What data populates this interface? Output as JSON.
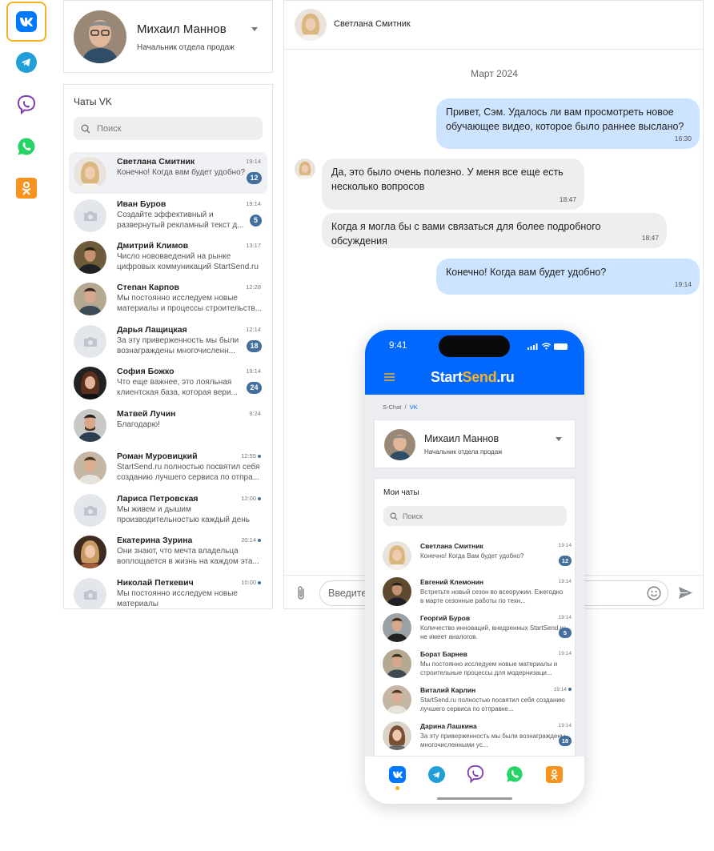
{
  "rail": {
    "items": [
      {
        "name": "vk-icon",
        "glyph": "VK",
        "color": "#0077ff",
        "active": true
      },
      {
        "name": "telegram-icon",
        "color": "#229ed9"
      },
      {
        "name": "viber-icon",
        "color": "#7d3daf"
      },
      {
        "name": "whatsapp-icon",
        "color": "#25d366"
      },
      {
        "name": "odnoklassniki-icon",
        "color": "#f7931e"
      }
    ]
  },
  "profile": {
    "name": "Михаил Маннов",
    "role": "Начальник отдела продаж"
  },
  "chat_list": {
    "title": "Чаты VK",
    "search_placeholder": "Поиск",
    "items": [
      {
        "name": "Светлана Смитник",
        "preview": "Конечно! Когда вам будет удобно?",
        "time": "19:14",
        "badge": "12"
      },
      {
        "name": "Иван Буров",
        "preview": "Создайте эффективный и развернутый рекламный текст д...",
        "time": "19:14",
        "badge": "5"
      },
      {
        "name": "Дмитрий Климов",
        "preview": "Число нововведений на рынке цифровых коммуникаций StartSend.ru",
        "time": "13:17"
      },
      {
        "name": "Степан Карпов",
        "preview": "Мы постоянно исследуем новые материалы и процессы строительств...",
        "time": "12:28"
      },
      {
        "name": "Дарья Лащицкая",
        "preview": "За эту приверженность мы были вознаграждены многочисленн...",
        "time": "12:14",
        "badge": "18"
      },
      {
        "name": "София Божко",
        "preview": "Что еще важнее, это лояльная клиентская база, которая вери...",
        "time": "19:14",
        "badge": "24"
      },
      {
        "name": "Матвей Лучин",
        "preview": "Благодарю!",
        "time": "9:24"
      },
      {
        "name": "Роман Муровицкий",
        "preview": "StartSend.ru полностью посвятил себя созданию лучшего сервиса по отпра...",
        "time": "12:55"
      },
      {
        "name": "Лариса Петровская",
        "preview": "Мы живем и дышим производительностью каждый день",
        "time": "12:00"
      },
      {
        "name": "Екатерина Зурина",
        "preview": "Они знают, что мечта владельца воплощается в жизнь на каждом эта...",
        "time": "20:14"
      },
      {
        "name": "Николай Петкевич",
        "preview": "Мы постоянно исследуем новые материалы",
        "time": "10:00"
      }
    ]
  },
  "conversation": {
    "contact": "Светлана Смитник",
    "date_divider": "Март 2024",
    "messages": [
      {
        "dir": "out",
        "text": "Привет, Сэм. Удалось ли вам просмотреть новое обучающее видео, которое было раннее выслано?",
        "time": "16:30"
      },
      {
        "dir": "in",
        "text": "Да, это было очень полезно. У меня все еще есть несколько вопросов",
        "time": "18:47"
      },
      {
        "dir": "in",
        "text": "Когда я могла бы с вами связаться для более подробного обсуждения",
        "time": "18:47"
      },
      {
        "dir": "out",
        "text": "Конечно! Когда вам будет удобно?",
        "time": "19:14"
      }
    ],
    "input_placeholder": "Введите"
  },
  "phone": {
    "clock": "9:41",
    "brand_a": "Start",
    "brand_b": "Send",
    "brand_c": ".ru",
    "breadcrumb_root": "S-Chat",
    "breadcrumb_sep": "/",
    "breadcrumb_current": "VK",
    "profile": {
      "name": "Михаил Маннов",
      "role": "Начальник отдела продаж"
    },
    "list_title": "Мои чаты",
    "search_placeholder": "Поиск",
    "items": [
      {
        "name": "Светлана Смитник",
        "preview": "Конечно! Когда Вам будет удобно?",
        "time": "19:14",
        "badge": "12"
      },
      {
        "name": "Евгений Клемонин",
        "preview": "Встретьте новый сезон во всеоружии. Ежегодно в марте сезонные работы по техн...",
        "time": "19:14"
      },
      {
        "name": "Георгий Буров",
        "preview": "Количество инноваций, внедренных StartSend.ru, не имеет аналогов.",
        "time": "19:14",
        "badge": "5"
      },
      {
        "name": "Борат Барнев",
        "preview": "Мы постоянно исследуем новые материалы и строительные процессы для модернизаци...",
        "time": "19:14"
      },
      {
        "name": "Виталий Карлин",
        "preview": "StartSend.ru полностью посвятил себя созданию лучшего сервиса по отправке...",
        "time": "19:14"
      },
      {
        "name": "Дарина Лашкина",
        "preview": "За эту приверженность мы были вознаграждены многочисленными ус...",
        "time": "19:14",
        "badge": "18"
      }
    ],
    "accent_color": "#0068ff",
    "brand_yellow": "#f5b324"
  }
}
